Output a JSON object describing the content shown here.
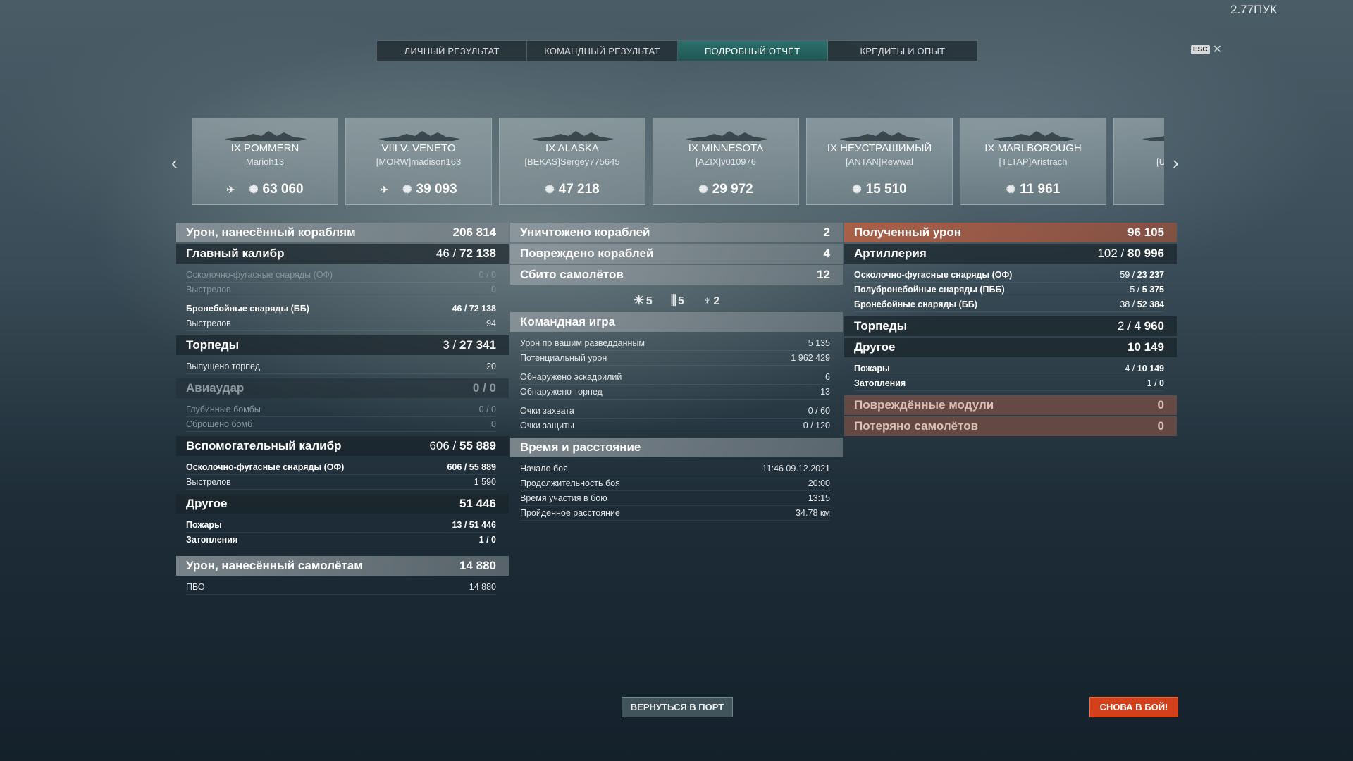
{
  "version": "2.77ПУК",
  "esc": {
    "key": "ESC",
    "close": "✕"
  },
  "tabs": [
    {
      "label": "ЛИЧНЫЙ РЕЗУЛЬТАТ"
    },
    {
      "label": "КОМАНДНЫЙ РЕЗУЛЬТАТ"
    },
    {
      "label": "ПОДРОБНЫЙ ОТЧЁТ",
      "active": true
    },
    {
      "label": "КРЕДИТЫ И ОПЫТ"
    }
  ],
  "nav": {
    "prev": "‹",
    "next": "›"
  },
  "ships": [
    {
      "name": "IX POMMERN",
      "player": "Marioh13",
      "damage": "63 060",
      "plane": true
    },
    {
      "name": "VIII V. VENETO",
      "player": "[MORW]madison163",
      "damage": "39 093",
      "plane": true
    },
    {
      "name": "IX ALASKA",
      "player": "[BEKAS]Sergey775645",
      "damage": "47 218"
    },
    {
      "name": "IX MINNESOTA",
      "player": "[AZIX]v010976",
      "damage": "29 972"
    },
    {
      "name": "IX НЕУСТРАШИМЫЙ",
      "player": "[ANTAN]Rewwal",
      "damage": "15 510"
    },
    {
      "name": "IX MARLBOROUGH",
      "player": "[TLTAP]Aristrach",
      "damage": "11 961"
    },
    {
      "name": "",
      "player": "[U",
      "damage": ""
    }
  ],
  "left": {
    "ship_damage": {
      "label": "Урон, нанесённый кораблям",
      "value": "206 814"
    },
    "main_battery": {
      "label": "Главный калибр",
      "value_a": "46 /",
      "value_b": "72 138"
    },
    "mb_rows": [
      {
        "label": "Осколочно-фугасные снаряды (ОФ)",
        "value": "0 / 0",
        "dim": true,
        "bold": false
      },
      {
        "label": "Выстрелов",
        "value": "0",
        "dim": true
      },
      {
        "label": "Бронебойные снаряды (ББ)",
        "value": "46 / 72 138",
        "bold": true
      },
      {
        "label": "Выстрелов",
        "value": "94"
      }
    ],
    "torpedoes": {
      "label": "Торпеды",
      "value_a": "3 /",
      "value_b": "27 341"
    },
    "torp_rows": [
      {
        "label": "Выпущено торпед",
        "value": "20"
      }
    ],
    "airstrike": {
      "label": "Авиаудар",
      "value": "0 / 0"
    },
    "air_rows": [
      {
        "label": "Глубинные бомбы",
        "value": "0 / 0"
      },
      {
        "label": "Сброшено бомб",
        "value": "0"
      }
    ],
    "secondary": {
      "label": "Вспомогательный калибр",
      "value_a": "606 /",
      "value_b": "55 889"
    },
    "sec_rows": [
      {
        "label": "Осколочно-фугасные снаряды (ОФ)",
        "value": "606 / 55 889"
      },
      {
        "label": "Выстрелов",
        "value": "1 590"
      }
    ],
    "other": {
      "label": "Другое",
      "value": "51 446"
    },
    "other_rows": [
      {
        "label": "Пожары",
        "value": "13 / 51 446"
      },
      {
        "label": "Затопления",
        "value": "1 / 0"
      }
    ],
    "plane_damage": {
      "label": "Урон, нанесённый самолётам",
      "value": "14 880"
    },
    "plane_rows": [
      {
        "label": "ПВО",
        "value": "14 880"
      }
    ]
  },
  "middle": {
    "destroyed": {
      "label": "Уничтожено кораблей",
      "value": "2"
    },
    "damaged": {
      "label": "Повреждено кораблей",
      "value": "4"
    },
    "planes": {
      "label": "Сбито самолётов",
      "value": "12"
    },
    "icons": [
      {
        "name": "spotting-icon",
        "glyph": "☀",
        "value": "5"
      },
      {
        "name": "shells-icon",
        "glyph": "⫼",
        "value": "5"
      },
      {
        "name": "fire-icon",
        "glyph": "♆",
        "value": "2"
      }
    ],
    "team_play": {
      "label": "Командная игра"
    },
    "team_rows": [
      {
        "label": "Урон по вашим разведданным",
        "value": "5 135"
      },
      {
        "label": "Потенциальный урон",
        "value": "1 962 429"
      },
      {
        "label": "Обнаружено эскадрилий",
        "value": "6"
      },
      {
        "label": "Обнаружено торпед",
        "value": "13"
      },
      {
        "label": "Очки захвата",
        "value": "0 / 60"
      },
      {
        "label": "Очки защиты",
        "value": "0 / 120"
      }
    ],
    "time": {
      "label": "Время и расстояние"
    },
    "time_rows": [
      {
        "label": "Начало боя",
        "value": "11:46  09.12.2021"
      },
      {
        "label": "Продолжительность боя",
        "value": "20:00"
      },
      {
        "label": "Время участия в бою",
        "value": "13:15"
      },
      {
        "label": "Пройденное расстояние",
        "value": "34.78 км"
      }
    ]
  },
  "right": {
    "received": {
      "label": "Полученный урон",
      "value": "96 105"
    },
    "artillery": {
      "label": "Артиллерия",
      "value_a": "102 /",
      "value_b": "80 996"
    },
    "art_rows": [
      {
        "label": "Осколочно-фугасные снаряды (ОФ)",
        "value_a": "59 /",
        "value_b": "23 237"
      },
      {
        "label": "Полубронебойные снаряды (ПББ)",
        "value_a": "5 /",
        "value_b": "5 375"
      },
      {
        "label": "Бронебойные снаряды (ББ)",
        "value_a": "38 /",
        "value_b": "52 384"
      }
    ],
    "torpedoes": {
      "label": "Торпеды",
      "value_a": "2 /",
      "value_b": "4 960"
    },
    "other": {
      "label": "Другое",
      "value": "10 149"
    },
    "other_rows": [
      {
        "label": "Пожары",
        "value_a": "4 /",
        "value_b": "10 149"
      },
      {
        "label": "Затопления",
        "value_a": "1 /",
        "value_b": "0"
      }
    ],
    "modules": {
      "label": "Повреждённые модули",
      "value": "0"
    },
    "planes_lost": {
      "label": "Потеряно самолётов",
      "value": "0"
    }
  },
  "buttons": {
    "port": "ВЕРНУТЬСЯ В ПОРТ",
    "battle": "СНОВА В БОЙ!"
  }
}
